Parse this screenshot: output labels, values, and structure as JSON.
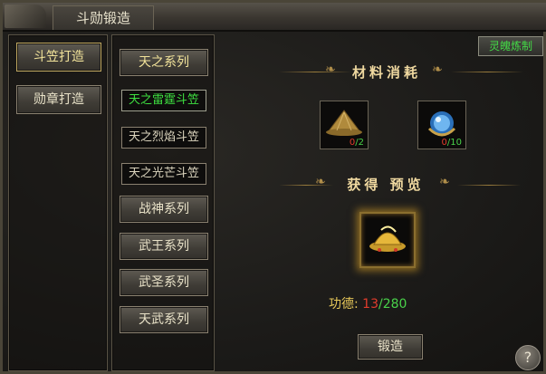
{
  "window": {
    "title": "斗勋锻造"
  },
  "left_tabs": [
    {
      "label": "斗笠打造",
      "active": true
    },
    {
      "label": "勋章打造",
      "active": false
    }
  ],
  "series_list": [
    {
      "label": "天之系列",
      "kind": "category"
    },
    {
      "label": "天之雷霆斗笠",
      "kind": "item",
      "selected": true
    },
    {
      "label": "天之烈焰斗笠",
      "kind": "item"
    },
    {
      "label": "天之光芒斗笠",
      "kind": "item"
    },
    {
      "label": "战神系列",
      "kind": "category"
    },
    {
      "label": "武王系列",
      "kind": "category"
    },
    {
      "label": "武圣系列",
      "kind": "category"
    },
    {
      "label": "天武系列",
      "kind": "category"
    }
  ],
  "refine_button": "灵魄炼制",
  "materials": {
    "title": "材料消耗",
    "items": [
      {
        "icon": "straw-hat-icon",
        "have": "0",
        "sep": "/",
        "need": "2"
      },
      {
        "icon": "blue-orb-icon",
        "have": "0",
        "sep": "/",
        "need": "10"
      }
    ]
  },
  "preview": {
    "title": "获得 预览",
    "icon": "golden-hat-icon"
  },
  "merit": {
    "label": "功德:",
    "current": "13",
    "sep": "/",
    "required": "280"
  },
  "forge_button": "锻造",
  "help_label": "?",
  "colors": {
    "selected": "#3ee040",
    "count_red": "#e23c2c",
    "count_green": "#49d24a",
    "gold": "#e8c95a"
  }
}
